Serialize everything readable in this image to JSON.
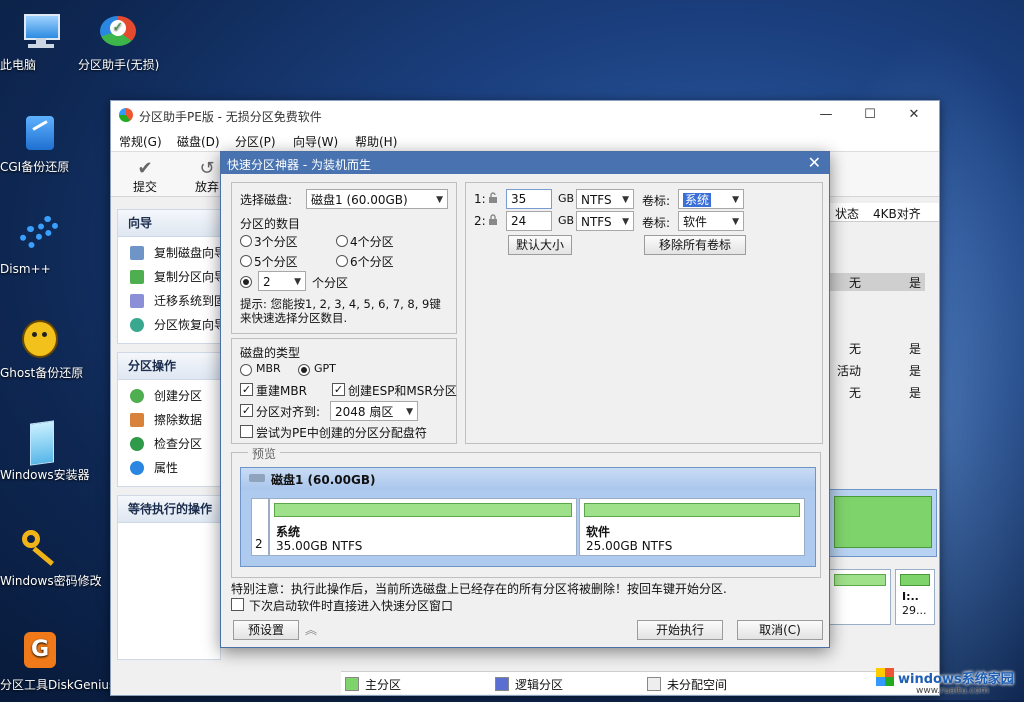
{
  "desktop": {
    "icons": [
      {
        "label": "此电脑"
      },
      {
        "label": "分区助手(无损)"
      },
      {
        "label": "CGI备份还原"
      },
      {
        "label": "Dism++"
      },
      {
        "label": "Ghost备份还原"
      },
      {
        "label": "Windows安装器"
      },
      {
        "label": "Windows密码修改"
      },
      {
        "label": "分区工具DiskGenius"
      }
    ]
  },
  "app": {
    "title": "分区助手PE版 - 无损分区免费软件",
    "window_controls": {
      "minimize": "—",
      "maximize": "☐",
      "close": "✕"
    },
    "menu": [
      "常规(G)",
      "磁盘(D)",
      "分区(P)",
      "向导(W)",
      "帮助(H)"
    ],
    "toolbar": [
      {
        "label": "提交",
        "icon": "check-icon"
      },
      {
        "label": "放弃",
        "icon": "discard-icon"
      }
    ],
    "sidebar": {
      "wizard": {
        "title": "向导",
        "items": [
          "复制磁盘向导",
          "复制分区向导",
          "迁移系统到固态",
          "分区恢复向导"
        ]
      },
      "ops": {
        "title": "分区操作",
        "items": [
          "创建分区",
          "擦除数据",
          "检查分区",
          "属性"
        ]
      },
      "pending": {
        "title": "等待执行的操作"
      }
    },
    "table": {
      "headers": [
        "状态",
        "4KB对齐"
      ],
      "rows": [
        [
          "无",
          "是"
        ],
        [
          "无",
          "是"
        ],
        [
          "活动",
          "是"
        ],
        [
          "无",
          "是"
        ]
      ]
    },
    "right_disk": {
      "label": "I:..",
      "size": "29..."
    },
    "legend": [
      "主分区",
      "逻辑分区",
      "未分配空间"
    ],
    "legend_colors": {
      "primary": "#7fd36b",
      "logical": "#5b6fd3",
      "unallocated": "#eeeeee"
    }
  },
  "dialog": {
    "title": "快速分区神器 - 为装机而生",
    "close": "✕",
    "disk_label": "选择磁盘:",
    "disk_value": "磁盘1 (60.00GB)",
    "count_label": "分区的数目",
    "count_options": [
      "3个分区",
      "4个分区",
      "5个分区",
      "6个分区"
    ],
    "custom_count": "2",
    "custom_suffix": "个分区",
    "hint": "提示: 您能按1, 2, 3, 4, 5, 6, 7, 8, 9键来快速选择分区数目.",
    "partitions": [
      {
        "index": "1:",
        "size": "35",
        "unit": "GB",
        "fs": "NTFS",
        "vol_label": "卷标:",
        "vol": "系统"
      },
      {
        "index": "2:",
        "size": "24",
        "unit": "GB",
        "fs": "NTFS",
        "vol_label": "卷标:",
        "vol": "软件"
      }
    ],
    "default_size_btn": "默认大小",
    "remove_labels_btn": "移除所有卷标",
    "disk_type_title": "磁盘的类型",
    "mbr": "MBR",
    "gpt": "GPT",
    "rebuild_mbr": "重建MBR",
    "create_esp": "创建ESP和MSR分区",
    "align_label": "分区对齐到:",
    "align_value": "2048 扇区",
    "try_letters": "尝试为PE中创建的分区分配盘符",
    "preview_title": "预览",
    "preview_disk": "磁盘1 (60.00GB)",
    "preview_index": "2",
    "preview_parts": [
      {
        "name": "系统",
        "size": "35.00GB NTFS"
      },
      {
        "name": "软件",
        "size": "25.00GB NTFS"
      }
    ],
    "warning": "特别注意：执行此操作后，当前所选磁盘上已经存在的所有分区将被删除！按回车键开始分区.",
    "next_boot": "下次启动软件时直接进入快速分区窗口",
    "presets_btn": "预设置",
    "start_btn": "开始执行",
    "cancel_btn": "取消(C)"
  },
  "watermark": {
    "text": "windows系统家园",
    "url": "www.ruaitu.com"
  }
}
